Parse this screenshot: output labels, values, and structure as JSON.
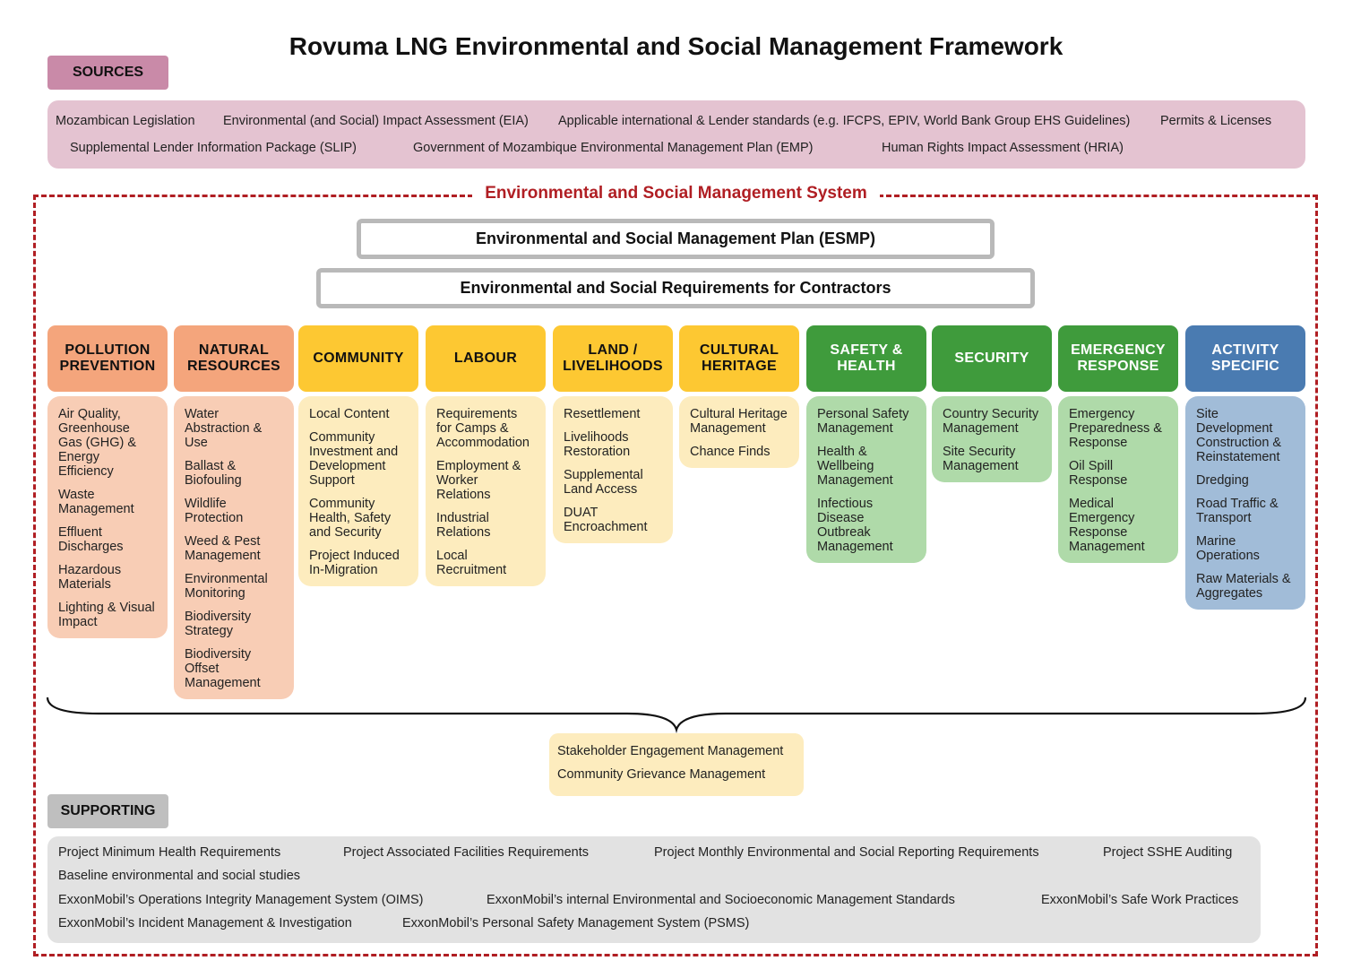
{
  "title": "Rovuma LNG Environmental and Social Management Framework",
  "sources": {
    "label": "SOURCES",
    "items": [
      "Mozambican Legislation",
      "Environmental (and Social) Impact Assessment (EIA)",
      "Applicable international & Lender standards (e.g. IFCPS, EPIV, World Bank Group EHS Guidelines)",
      "Permits & Licenses",
      "Supplemental Lender Information Package (SLIP)",
      "Government of Mozambique Environmental Management Plan (EMP)",
      "Human Rights Impact Assessment (HRIA)"
    ]
  },
  "ems": {
    "title": "Environmental and Social Management System",
    "esmp": "Environmental and Social Management Plan (ESMP)",
    "contractors": "Environmental and Social Requirements for Contractors"
  },
  "colors": {
    "orange_head": "#f4a57c",
    "orange_body": "#f8cdb5",
    "yellow_head": "#fdc832",
    "yellow_body": "#fdecbe",
    "green_head": "#3f9b3c",
    "green_body": "#afdaa9",
    "blue_head": "#4a7bb1",
    "blue_body": "#a1bcd8",
    "sources_tag": "#c98aa8",
    "sources_box": "#e4c3d1",
    "supporting_tag": "#bfbfbf",
    "supporting_box": "#e2e2e2",
    "ems_red": "#b01e23"
  },
  "categories": [
    {
      "title": "POLLUTION\nPREVENTION",
      "color": "orange",
      "items": [
        "Air Quality,\nGreenhouse\nGas (GHG) &\nEnergy\nEfficiency",
        "Waste\nManagement",
        "Effluent\nDischarges",
        "Hazardous\nMaterials",
        "Lighting & Visual\nImpact"
      ]
    },
    {
      "title": "NATURAL\nRESOURCES",
      "color": "orange",
      "items": [
        "Water\nAbstraction &\nUse",
        "Ballast &\nBiofouling",
        "Wildlife\nProtection",
        "Weed & Pest\nManagement",
        "Environmental\nMonitoring",
        "Biodiversity\nStrategy",
        "Biodiversity\nOffset\nManagement"
      ]
    },
    {
      "title": "COMMUNITY",
      "color": "yellow",
      "items": [
        "Local Content",
        "Community\nInvestment and\nDevelopment\nSupport",
        "Community\nHealth, Safety\nand Security",
        "Project Induced\nIn-Migration"
      ]
    },
    {
      "title": "LABOUR",
      "color": "yellow",
      "items": [
        "Requirements\nfor Camps &\nAccommodation",
        "Employment &\nWorker\nRelations",
        "Industrial\nRelations",
        "Local\nRecruitment"
      ]
    },
    {
      "title": "LAND /\nLIVELIHOODS",
      "color": "yellow",
      "items": [
        "Resettlement",
        "Livelihoods\nRestoration",
        "Supplemental\nLand Access",
        "DUAT\nEncroachment"
      ]
    },
    {
      "title": "CULTURAL\nHERITAGE",
      "color": "yellow",
      "items": [
        "Cultural Heritage\nManagement",
        "Chance Finds"
      ]
    },
    {
      "title": "SAFETY &\nHEALTH",
      "color": "green",
      "items": [
        "Personal Safety\nManagement",
        "Health &\nWellbeing\nManagement",
        "Infectious\nDisease\nOutbreak\nManagement"
      ]
    },
    {
      "title": "SECURITY",
      "color": "green",
      "items": [
        "Country Security\nManagement",
        "Site Security\nManagement"
      ]
    },
    {
      "title": "EMERGENCY\nRESPONSE",
      "color": "green",
      "items": [
        "Emergency\nPreparedness &\nResponse",
        "Oil Spill\nResponse",
        "Medical\nEmergency\nResponse\nManagement"
      ]
    },
    {
      "title": "ACTIVITY\nSPECIFIC",
      "color": "blue",
      "items": [
        "Site\nDevelopment\nConstruction &\nReinstatement",
        "Dredging",
        "Road Traffic &\nTransport",
        "Marine\nOperations",
        "Raw Materials &\nAggregates"
      ]
    }
  ],
  "stakeholder": [
    "Stakeholder Engagement Management",
    "Community Grievance Management"
  ],
  "supporting": {
    "label": "SUPPORTING",
    "items": [
      "Project Minimum Health Requirements",
      "Project Associated Facilities Requirements",
      "Project Monthly Environmental and Social Reporting Requirements",
      "Project SSHE Auditing",
      "Baseline environmental and social studies",
      "ExxonMobil’s Operations Integrity Management System (OIMS)",
      "ExxonMobil’s internal Environmental and Socioeconomic Management Standards",
      "ExxonMobil’s Safe Work Practices",
      "ExxonMobil’s Incident Management & Investigation",
      "ExxonMobil’s Personal Safety Management System (PSMS)"
    ]
  }
}
